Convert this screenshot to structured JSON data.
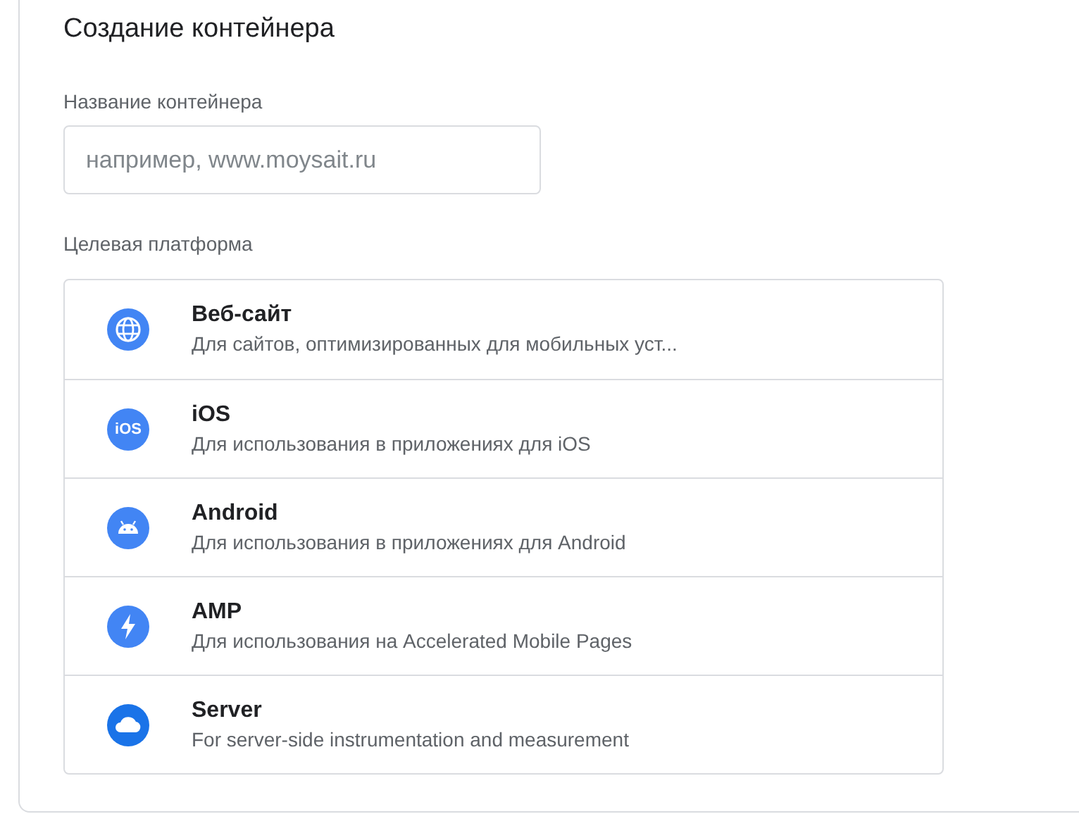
{
  "title": "Создание контейнера",
  "name_field": {
    "label": "Название контейнера",
    "placeholder": "например, www.moysait.ru"
  },
  "platform": {
    "label": "Целевая платформа",
    "options": [
      {
        "kind": "web",
        "title": "Веб-сайт",
        "description": "Для сайтов, оптимизированных для мобильных уст..."
      },
      {
        "kind": "ios",
        "icon_label": "iOS",
        "title": "iOS",
        "description": "Для использования в приложениях для iOS"
      },
      {
        "kind": "android",
        "title": "Android",
        "description": "Для использования в приложениях для Android"
      },
      {
        "kind": "amp",
        "title": "AMP",
        "description": "Для использования на Accelerated Mobile Pages"
      },
      {
        "kind": "server",
        "title": "Server",
        "description": "For server-side instrumentation and measurement"
      }
    ]
  }
}
